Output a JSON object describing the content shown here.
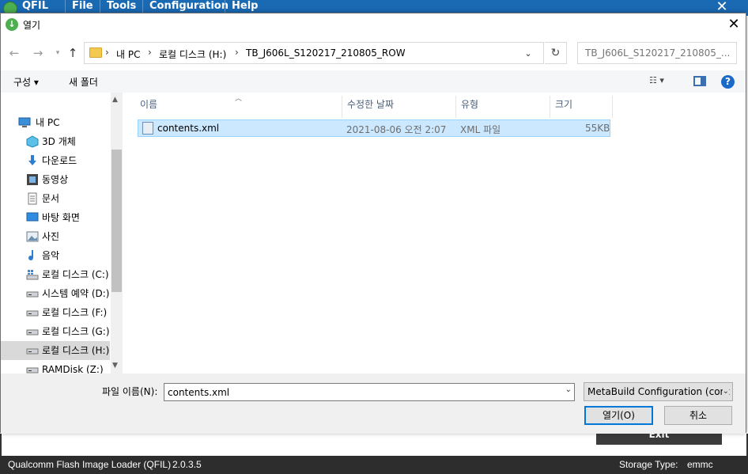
{
  "qfil": {
    "logo_text": "QFIL",
    "menus": [
      "File",
      "Tools",
      "Configuration",
      "Help"
    ],
    "exit_label": "Exit",
    "status": {
      "app_name": "Qualcomm Flash Image Loader (QFIL)",
      "version": "2.0.3.5",
      "storage_label": "Storage Type:",
      "storage_value": "emmc"
    }
  },
  "dialog": {
    "title": "열기",
    "address": {
      "crumbs": [
        "내 PC",
        "로컬 디스크 (H:)",
        "TB_J606L_S120217_210805_ROW"
      ]
    },
    "search": {
      "placeholder": "TB_J606L_S120217_210805_..."
    },
    "toolbar": {
      "organize": "구성 ▾",
      "new_folder": "새 폴더"
    },
    "nav_items": [
      {
        "label": "내 PC",
        "icon": "pc-icon"
      },
      {
        "label": "3D 개체",
        "icon": "cube-icon"
      },
      {
        "label": "다운로드",
        "icon": "download-icon"
      },
      {
        "label": "동영상",
        "icon": "video-icon"
      },
      {
        "label": "문서",
        "icon": "document-icon"
      },
      {
        "label": "바탕 화면",
        "icon": "desktop-icon"
      },
      {
        "label": "사진",
        "icon": "picture-icon"
      },
      {
        "label": "음악",
        "icon": "music-icon"
      },
      {
        "label": "로컬 디스크 (C:)",
        "icon": "drive-icon"
      },
      {
        "label": "시스템 예약 (D:)",
        "icon": "drive-icon"
      },
      {
        "label": "로컬 디스크 (F:)",
        "icon": "drive-icon"
      },
      {
        "label": "로컬 디스크 (G:)",
        "icon": "drive-icon"
      },
      {
        "label": "로컬 디스크 (H:)",
        "icon": "drive-icon",
        "selected": true
      },
      {
        "label": "RAMDisk (Z:)",
        "icon": "drive-icon"
      }
    ],
    "columns": [
      "이름",
      "수정한 날짜",
      "유형",
      "크기"
    ],
    "files": [
      {
        "name": "contents.xml",
        "modified": "2021-08-06 오전 2:07",
        "type": "XML 파일",
        "size": "55KB"
      }
    ],
    "filename_label": "파일 이름(N):",
    "filename_value": "contents.xml",
    "filter": "MetaBuild Configuration (cont",
    "open_label": "열기(O)",
    "cancel_label": "취소",
    "colors": {
      "selection": "#cce8ff",
      "accent": "#0078d7",
      "qfil_blue": "#1a69b3"
    }
  }
}
